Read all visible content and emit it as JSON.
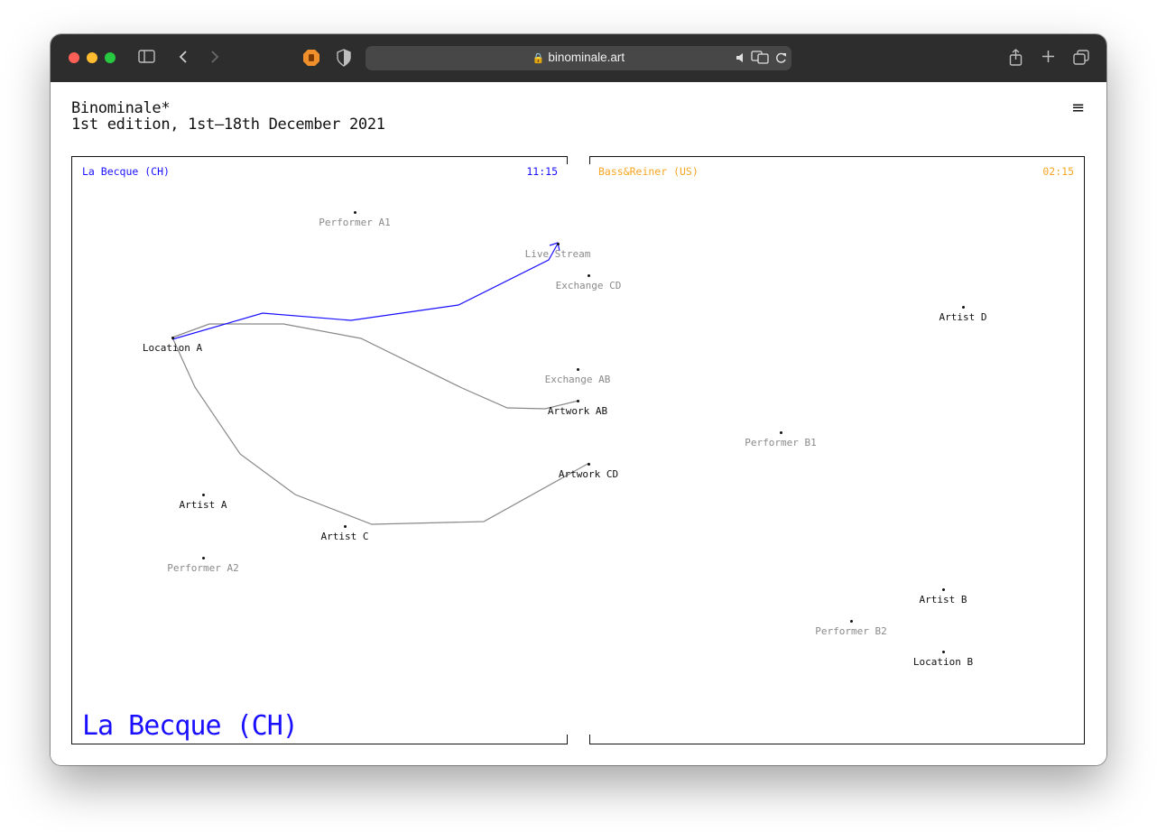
{
  "browser": {
    "url": "binominale.art",
    "traffic_light_colors": {
      "close": "#ff5f57",
      "minimize": "#febc2e",
      "zoom": "#28c840"
    }
  },
  "site": {
    "title_line1": "Binominale*",
    "title_line2": "1st edition, 1st–18th December 2021",
    "menu_glyph": "≡"
  },
  "panels": {
    "left": {
      "name": "La Becque (CH)",
      "time": "11:15",
      "color": "#1a10ff",
      "big_label": "La Becque (CH)"
    },
    "right": {
      "name": "Bass&Reiner (US)",
      "time": "02:15",
      "color": "#f5a623"
    }
  },
  "nodes": [
    {
      "id": "performer-a1",
      "label": "Performer A1",
      "style": "faint"
    },
    {
      "id": "live-stream",
      "label": "Live Stream",
      "style": "faint"
    },
    {
      "id": "exchange-cd",
      "label": "Exchange CD",
      "style": "faint"
    },
    {
      "id": "location-a",
      "label": "Location A",
      "style": "dark"
    },
    {
      "id": "artist-d",
      "label": "Artist D",
      "style": "dark"
    },
    {
      "id": "exchange-ab",
      "label": "Exchange AB",
      "style": "faint"
    },
    {
      "id": "artwork-ab",
      "label": "Artwork AB",
      "style": "dark"
    },
    {
      "id": "performer-b1",
      "label": "Performer B1",
      "style": "faint"
    },
    {
      "id": "artwork-cd",
      "label": "Artwork CD",
      "style": "dark"
    },
    {
      "id": "artist-a",
      "label": "Artist A",
      "style": "dark"
    },
    {
      "id": "artist-c",
      "label": "Artist C",
      "style": "dark"
    },
    {
      "id": "performer-a2",
      "label": "Performer A2",
      "style": "faint"
    },
    {
      "id": "artist-b",
      "label": "Artist B",
      "style": "dark"
    },
    {
      "id": "performer-b2",
      "label": "Performer B2",
      "style": "faint"
    },
    {
      "id": "location-b",
      "label": "Location B",
      "style": "dark"
    }
  ],
  "paths": [
    {
      "id": "path-location-a-live-stream",
      "color": "#1a10ff",
      "arrow": true
    },
    {
      "id": "path-location-a-artwork-ab",
      "color": "#888888",
      "arrow": false
    },
    {
      "id": "path-location-a-artwork-cd",
      "color": "#888888",
      "arrow": false
    }
  ]
}
